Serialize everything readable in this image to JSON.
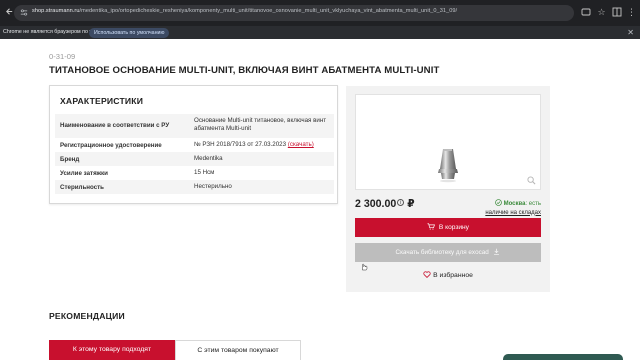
{
  "browser": {
    "url_host": "shop.straumann.ru",
    "url_path": "/medentika_ipo/ortopedicheskie_resheniya/komponenty_multi_unit/titanovoe_osnovanie_multi_unit_vklyuchaya_vint_abatmenta_multi_unit_0_31_09/"
  },
  "infobar": {
    "message": "Chrome не является браузером по умолчанию.",
    "button_label": "Использовать по умолчанию"
  },
  "product": {
    "sku": "0-31-09",
    "title": "ТИТАНОВОЕ ОСНОВАНИЕ MULTI-UNIT, ВКЛЮЧАЯ ВИНТ АБАТМЕНТА MULTI-UNIT"
  },
  "specs": {
    "heading": "ХАРАКТЕРИСТИКИ",
    "rows": [
      {
        "key": "Наименование в соответствии с РУ",
        "value_line1": "Основание Multi-unit титановое, включая винт",
        "value_line2": "абатмента Multi-unit"
      },
      {
        "key": "Регистрационное удостоверение",
        "value": "№ РЗН 2018/7913 от 27.03.2023",
        "link": "(скачать)"
      },
      {
        "key": "Бренд",
        "value": "Medentika"
      },
      {
        "key": "Усилие затяжки",
        "value": "15 Нсм"
      },
      {
        "key": "Стерильность",
        "value": "Нестерильно"
      }
    ]
  },
  "buy": {
    "price": "2 300.00",
    "currency": "₽",
    "info_icon_glyph": "i",
    "stock_city": "Москва",
    "stock_status": ": есть",
    "stock_link": "наличие на складах",
    "cart_label": "В корзину",
    "download_label": "Скачать библиотеку для exocad",
    "favorite_label": "В избранное"
  },
  "recommendations": {
    "heading": "РЕКОМЕНДАЦИИ",
    "tabs": [
      "К этому товару подходят",
      "С этим товаром покупают"
    ]
  },
  "colors": {
    "brand_red": "#c8102e",
    "stock_green": "#3a8a3a",
    "disabled_gray": "#bdbdbd"
  }
}
